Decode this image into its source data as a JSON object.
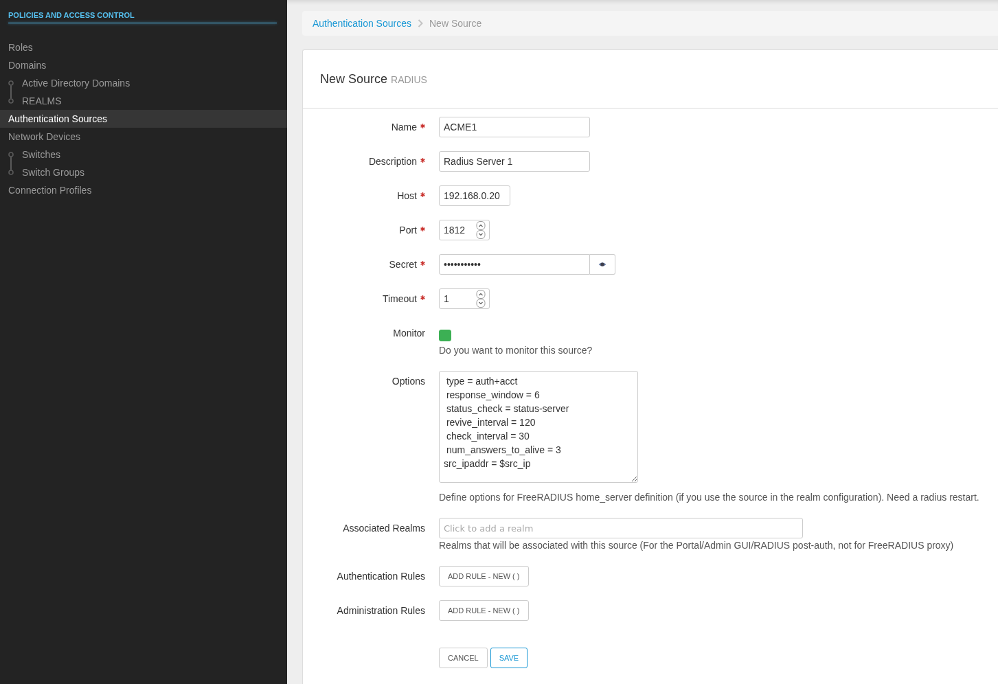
{
  "sidebar": {
    "heading": "POLICIES AND ACCESS CONTROL",
    "items": [
      {
        "label": "Roles",
        "selected": false
      },
      {
        "label": "Domains",
        "selected": false,
        "children": [
          {
            "label": "Active Directory Domains",
            "selected": false
          },
          {
            "label": "REALMS",
            "selected": false
          }
        ]
      },
      {
        "label": "Authentication Sources",
        "selected": true
      },
      {
        "label": "Network Devices",
        "selected": false,
        "children": [
          {
            "label": "Switches",
            "selected": false
          },
          {
            "label": "Switch Groups",
            "selected": false
          }
        ]
      },
      {
        "label": "Connection Profiles",
        "selected": false
      }
    ]
  },
  "breadcrumb": [
    {
      "label": "Authentication Sources",
      "kind": "link"
    },
    {
      "label": "New Source",
      "kind": "current"
    }
  ],
  "form": {
    "title": "New Source",
    "subtitle": "RADIUS",
    "fields": [
      {
        "kind": "text",
        "label": "Name",
        "required": true,
        "value": "ACME1"
      },
      {
        "kind": "text",
        "label": "Description",
        "required": true,
        "value": "Radius Server 1"
      },
      {
        "kind": "ip",
        "label": "Host",
        "required": true,
        "value": "192.168.0.20"
      },
      {
        "kind": "number",
        "label": "Port",
        "required": true,
        "value": "1812"
      },
      {
        "kind": "password",
        "label": "Secret",
        "required": true,
        "value": "•••••••••••"
      },
      {
        "kind": "number",
        "label": "Timeout",
        "required": true,
        "value": "1"
      },
      {
        "kind": "toggle",
        "label": "Monitor",
        "required": false,
        "checked": true,
        "help": "Do you want to monitor this source?"
      },
      {
        "kind": "textarea",
        "label": "Options",
        "required": false,
        "value": " type = auth+acct\n response_window = 6\n status_check = status-server\n revive_interval = 120\n check_interval = 30\n num_answers_to_alive = 3\nsrc_ipaddr = $src_ip",
        "help": "Define options for FreeRADIUS home_server definition (if you use the source in the realm configuration). Need a radius restart."
      },
      {
        "kind": "tags",
        "label": "Associated Realms",
        "required": false,
        "placeholder": "Click to add a realm",
        "help": "Realms that will be associated with this source (For the Portal/Admin GUI/RADIUS post-auth, not for FreeRADIUS proxy)"
      },
      {
        "kind": "rules",
        "label": "Authentication Rules",
        "required": false,
        "button": "ADD RULE - NEW ( )"
      },
      {
        "kind": "rules",
        "label": "Administration Rules",
        "required": false,
        "button": "ADD RULE - NEW ( )"
      }
    ],
    "actions": [
      {
        "label": "CANCEL",
        "kind": "default"
      },
      {
        "label": "SAVE",
        "kind": "primary"
      }
    ]
  }
}
